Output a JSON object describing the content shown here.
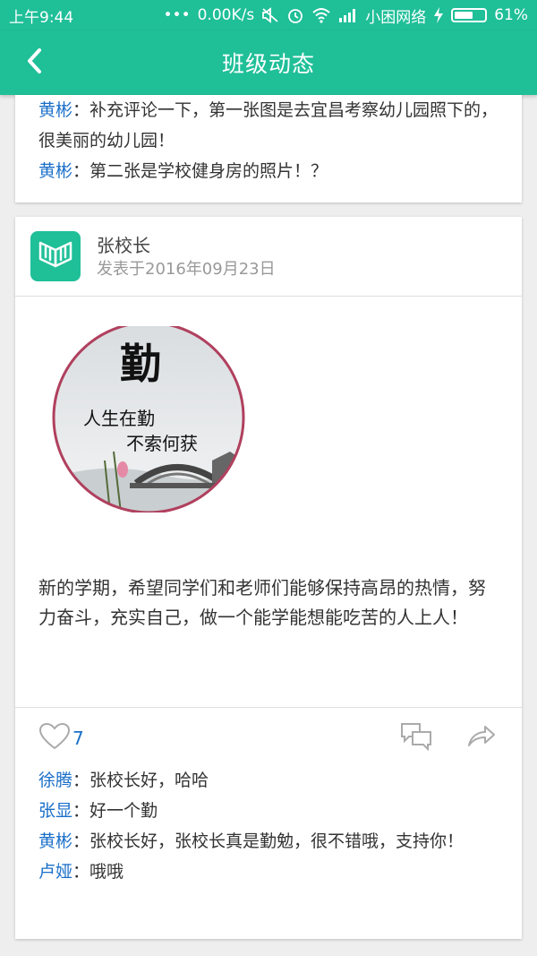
{
  "status_bar": {
    "time": "上午9:44",
    "dots": "•••",
    "speed": "0.00K/s",
    "carrier": "小困网络",
    "battery": "61%",
    "battery_fraction": 0.61
  },
  "header": {
    "title": "班级动态",
    "back_icon": "chevron-left-icon"
  },
  "colors": {
    "accent": "#1fbf98",
    "name_blue": "#1a6fc9"
  },
  "prev_post": {
    "comments": [
      {
        "name": "黄彬",
        "sep": "：",
        "text": "补充评论一下，第一张图是去宜昌考察幼儿园照下的，很美丽的幼儿园！"
      },
      {
        "name": "黄彬",
        "sep": "：",
        "text": "第二张是学校健身房的照片！？"
      }
    ]
  },
  "post": {
    "author": "张校长",
    "date": "发表于2016年09月23日",
    "avatar_icon": "book-logo-icon",
    "image": {
      "big_char": "勤",
      "line1": "人生在勤",
      "line2": "不索何获"
    },
    "text": "新的学期，希望同学们和老师们能够保持高昂的热情，努力奋斗，充实自己，做一个能学能想能吃苦的人上人！",
    "likes": "7",
    "comments": [
      {
        "name": "徐腾",
        "sep": "：",
        "text": "张校长好，哈哈"
      },
      {
        "name": "张显",
        "sep": "：",
        "text": "好一个勤"
      },
      {
        "name": "黄彬",
        "sep": "：",
        "text": "张校长好，张校长真是勤勉，很不错哦，支持你！"
      },
      {
        "name": "卢娅",
        "sep": "：",
        "text": "哦哦"
      }
    ]
  }
}
